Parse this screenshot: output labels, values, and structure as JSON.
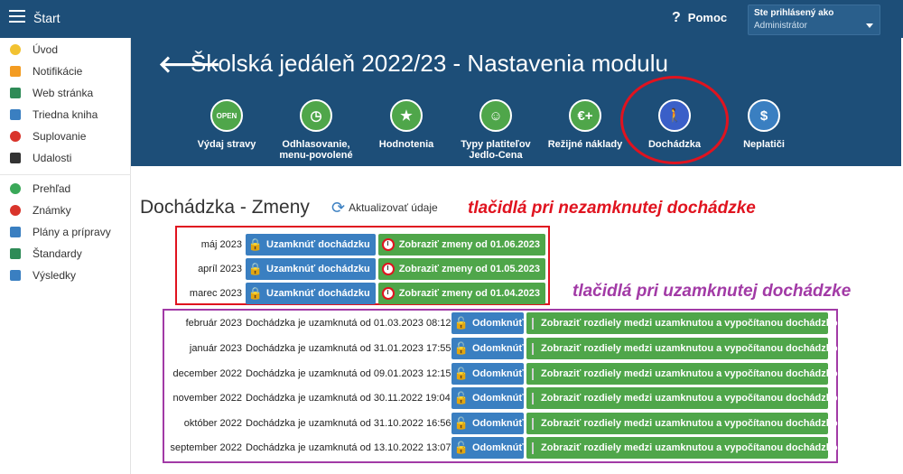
{
  "topbar": {
    "start_label": "Štart",
    "help_label": "Pomoc",
    "user_line1": "Ste prihlásený ako",
    "user_line2": "Administrátor"
  },
  "sidebar": {
    "items": [
      {
        "label": "Úvod",
        "icon": "star-icon",
        "color": "#f2c231"
      },
      {
        "label": "Notifikácie",
        "icon": "envelope-icon",
        "color": "#f39c22"
      },
      {
        "label": "Web stránka",
        "icon": "home-icon",
        "color": "#2e8b57"
      },
      {
        "label": "Triedna kniha",
        "icon": "book-icon",
        "color": "#3a7fc1"
      },
      {
        "label": "Suplovanie",
        "icon": "person-icon",
        "color": "#d9342b"
      },
      {
        "label": "Udalosti",
        "icon": "calendar-icon",
        "color": "#333333"
      },
      {
        "label": "Prehľad",
        "icon": "check-icon",
        "color": "#3aa858"
      },
      {
        "label": "Známky",
        "icon": "grade-icon",
        "color": "#d9342b"
      },
      {
        "label": "Plány a prípravy",
        "icon": "briefcase-icon",
        "color": "#3a7fc1"
      },
      {
        "label": "Štandardy",
        "icon": "shield-icon",
        "color": "#2e8b57"
      },
      {
        "label": "Výsledky",
        "icon": "bar-chart-icon",
        "color": "#3a7fc1"
      }
    ]
  },
  "header": {
    "title": "Školská jedáleň 2022/23 - Nastavenia modulu",
    "modules": [
      {
        "label": "Výdaj stravy",
        "icon": "open-sign-icon",
        "glyph": "OPEN",
        "color": "#4fa64a"
      },
      {
        "label": "Odhlasovanie,\nmenu-povolené",
        "icon": "clock-icon",
        "glyph": "◷",
        "color": "#4fa64a"
      },
      {
        "label": "Hodnotenia",
        "icon": "star-icon",
        "glyph": "★",
        "color": "#4fa64a"
      },
      {
        "label": "Typy platiteľov\nJedlo-Cena",
        "icon": "payer-icon",
        "glyph": "☺",
        "color": "#4fa64a"
      },
      {
        "label": "Režijné náklady",
        "icon": "euro-plus-icon",
        "glyph": "€+",
        "color": "#4fa64a"
      },
      {
        "label": "Dochádzka",
        "icon": "walking-icon",
        "glyph": "🚶",
        "color": "#3a5fc8"
      },
      {
        "label": "Neplatiči",
        "icon": "moneybag-icon",
        "glyph": "$",
        "color": "#3a7fc1"
      }
    ]
  },
  "main": {
    "section_title": "Dochádzka - Zmeny",
    "refresh_label": "Aktualizovať údaje",
    "annotation_unlocked": "tlačidlá pri nezamknutej dochádzke",
    "annotation_locked": "tlačidlá pri uzamknutej dochádzke",
    "lock_button_label": "Uzamknúť dochádzku",
    "unlock_button_label": "Odomknúť",
    "diff_button_label": "Zobraziť rozdiely medzi uzamknutou a vypočítanou dochádzkou",
    "unlocked_rows": [
      {
        "month": "máj 2023",
        "shift_label": "Zobraziť zmeny od 01.06.2023"
      },
      {
        "month": "apríl 2023",
        "shift_label": "Zobraziť zmeny od 01.05.2023"
      },
      {
        "month": "marec 2023",
        "shift_label": "Zobraziť zmeny od 01.04.2023"
      }
    ],
    "locked_rows": [
      {
        "month": "február 2023",
        "status": "Dochádzka je uzamknutá od 01.03.2023 08:12"
      },
      {
        "month": "január 2023",
        "status": "Dochádzka je uzamknutá od 31.01.2023 17:55"
      },
      {
        "month": "december 2022",
        "status": "Dochádzka je uzamknutá od 09.01.2023 12:15"
      },
      {
        "month": "november 2022",
        "status": "Dochádzka je uzamknutá od 30.11.2022 19:04"
      },
      {
        "month": "október 2022",
        "status": "Dochádzka je uzamknutá od 31.10.2022 16:56"
      },
      {
        "month": "september 2022",
        "status": "Dochádzka je uzamknutá od 13.10.2022 13:07"
      }
    ]
  }
}
